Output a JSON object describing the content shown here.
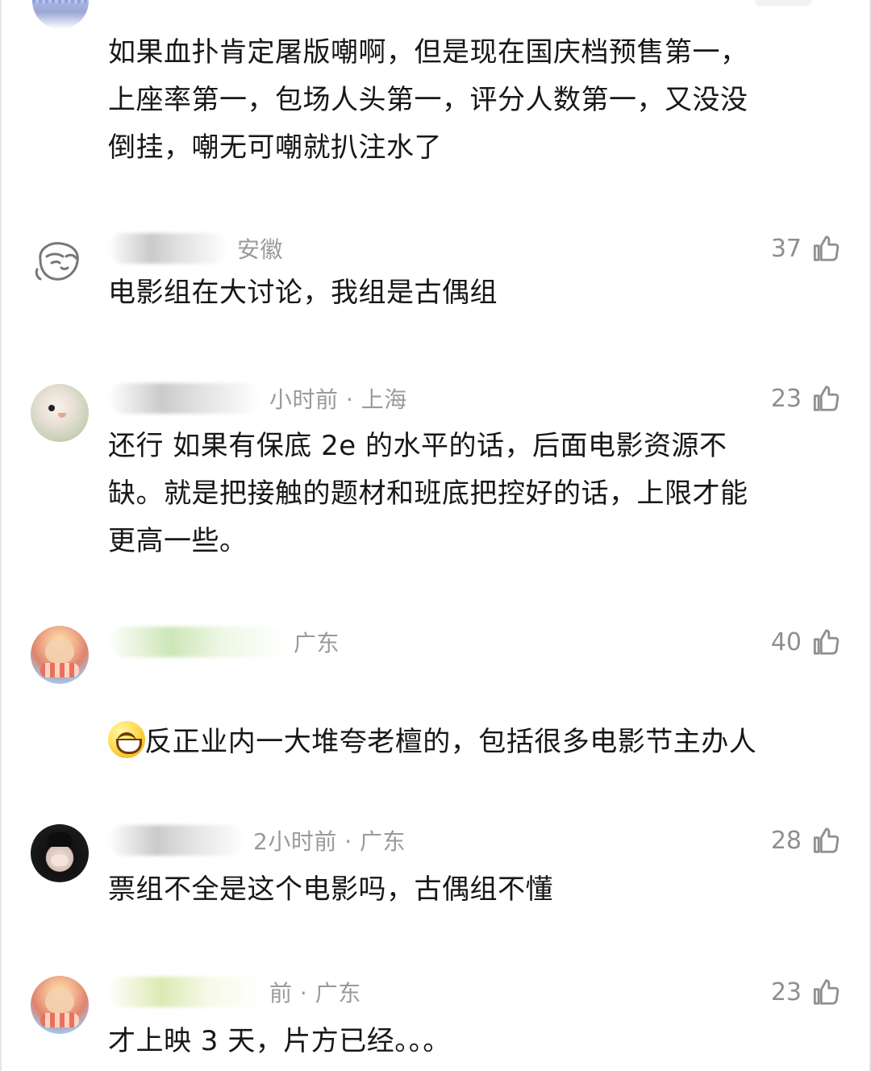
{
  "page": {
    "accent": "#9a9a9a",
    "text_color": "#171717"
  },
  "comments": [
    {
      "id": "c0",
      "avatar_icon": "avatar-top-icon",
      "meta": "",
      "likes": "",
      "text": "如果血扑肯定屠版嘲啊，但是现在国庆档预售第一，\n上座率第一，包场人头第一，评分人数第一，又没没\n倒挂，嘲无可嘲就扒注水了"
    },
    {
      "id": "c1",
      "avatar_icon": "doodle-avatar-icon",
      "meta": "安徽",
      "likes": "37",
      "text": "电影组在大讨论，我组是古偶组"
    },
    {
      "id": "c2",
      "avatar_icon": "bird-avatar-icon",
      "meta": "小时前 · 上海",
      "likes": "23",
      "text": "还行 如果有保底 2e 的水平的话，后面电影资源不\n缺。就是把接触的题材和班底把控好的话，上限才能\n更高一些。"
    },
    {
      "id": "c3",
      "avatar_icon": "game-character-avatar-icon",
      "meta": "广东",
      "likes": "40",
      "text": "反正业内一大堆夸老檀的，包括很多电影节主办人"
    },
    {
      "id": "c4",
      "avatar_icon": "girl-avatar-icon",
      "meta": "2小时前 · 广东",
      "likes": "28",
      "text": "票组不全是这个电影吗，古偶组不懂"
    },
    {
      "id": "c5",
      "avatar_icon": "game-character-avatar-icon",
      "meta": "前 · 广东",
      "likes": "23",
      "text": "才上映 3 天，片方已经。。。"
    }
  ]
}
